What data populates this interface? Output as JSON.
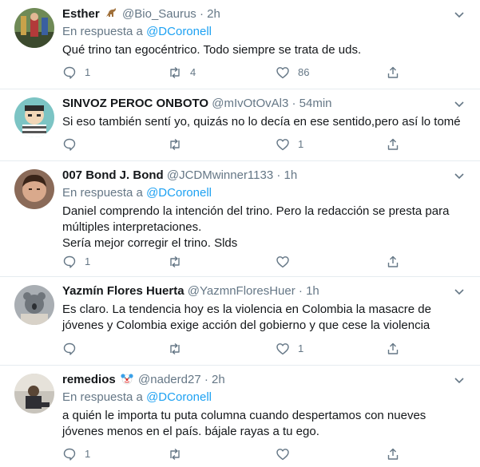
{
  "colors": {
    "accent": "#1da1f2",
    "secondary_text": "#657786",
    "divider": "#e6ecf0"
  },
  "tweets": [
    {
      "name": "Esther",
      "name_emoji": "dinosaur",
      "handle": "@Bio_Saurus",
      "dot": "·",
      "time": "2h",
      "reply_prefix": "En respuesta a",
      "reply_to": "@DCoronell",
      "text_lines": [
        "Qué trino tan egocéntrico. Todo siempre se trata de uds."
      ],
      "counts": {
        "reply": "1",
        "retweet": "4",
        "like": "86"
      }
    },
    {
      "name": "SINVOZ PEROC ONBOTO",
      "handle": "@mIvOtOvAl3",
      "dot": "·",
      "time": "54min",
      "text_lines": [
        "Si eso también sentí yo, quizás no lo decía en ese sentido,pero así lo tomé"
      ],
      "counts": {
        "reply": "",
        "retweet": "",
        "like": "1"
      }
    },
    {
      "name": "007 Bond J. Bond",
      "handle": "@JCDMwinner1133",
      "dot": "·",
      "time": "1h",
      "reply_prefix": "En respuesta a",
      "reply_to": "@DCoronell",
      "text_lines": [
        "Daniel comprendo la intención del trino. Pero la redacción se presta para",
        "múltiples interpretaciones.",
        "Sería mejor corregir el trino. Slds"
      ],
      "counts": {
        "reply": "1",
        "retweet": "",
        "like": ""
      }
    },
    {
      "name": "Yazmín Flores Huerta",
      "handle": "@YazmnFloresHuer",
      "dot": "·",
      "time": "1h",
      "text_lines": [
        "Es claro. La tendencia hoy es la violencia en Colombia la masacre de",
        "jóvenes y Colombia exige acción del gobierno y que cese la violencia"
      ],
      "counts": {
        "reply": "",
        "retweet": "",
        "like": "1"
      }
    },
    {
      "name": "remedios",
      "name_emoji": "clown-face",
      "handle": "@naderd27",
      "dot": "·",
      "time": "2h",
      "reply_prefix": "En respuesta a",
      "reply_to": "@DCoronell",
      "text_lines": [
        "a quién le importa tu puta columna cuando despertamos con nueves",
        "jóvenes menos en el país. bájale rayas a tu ego."
      ],
      "counts": {
        "reply": "1",
        "retweet": "",
        "like": ""
      }
    }
  ]
}
